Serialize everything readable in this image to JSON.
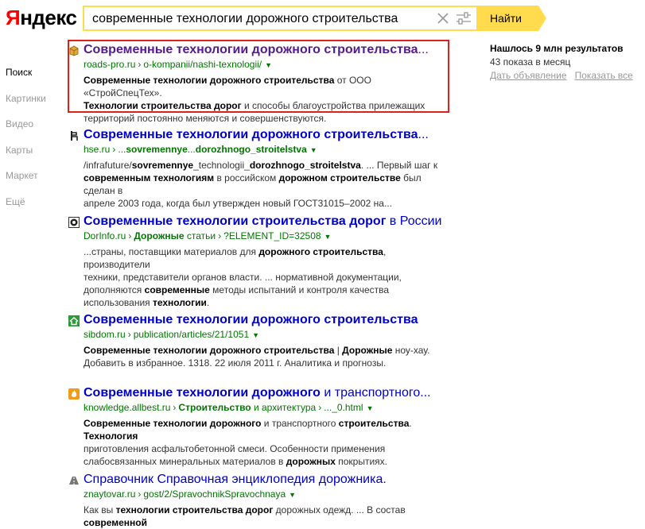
{
  "logo": {
    "part1": "Я",
    "part2": "ндекс"
  },
  "search": {
    "query": "современные технологии дорожного строительства",
    "button_label": "Найти"
  },
  "nav": [
    {
      "label": "Поиск",
      "active": true
    },
    {
      "label": "Картинки"
    },
    {
      "label": "Видео"
    },
    {
      "label": "Карты"
    },
    {
      "label": "Маркет"
    },
    {
      "label": "Ещё"
    }
  ],
  "results": [
    {
      "favicon": "box-icon",
      "title_html": "<b>Современные технологии дорожного строительства</b>...",
      "visited": true,
      "url_parts": [
        "roads-pro.ru",
        "o-kompanii/nashi-texnologii/"
      ],
      "snippet_html": "<b>Современные технологии дорожного строительства</b> от ООО «СтройСпецТех».<br><b>Технологии строительства дорог</b> и способы благоустройства прилежащих<br>территорий постоянно меняются и совершенствуются."
    },
    {
      "favicon": "hse-icon",
      "title_html": "<b>Современные технологии дорожного строительства</b>...",
      "url_parts": [
        "hse.ru",
        "...<b>sovremennye</b>...<b>dorozhnogo_stroitelstva</b>"
      ],
      "snippet_html": "/infrafuture/<b>sovremennye</b>_technologii_<b>dorozhnogo_stroitelstva</b>. ... Первый шаг к<br><b>современным технологиям</b> в российском <b>дорожном строительстве</b> был сделан в<br>апреле 2003 года, когда был утвержден новый ГОСТ31015–2002 на..."
    },
    {
      "favicon": "dorinfo-icon",
      "title_html": "<b>Современные технологии строительства дорог</b> в России",
      "url_parts": [
        "DorInfo.ru",
        "<b>Дорожные</b> статьи",
        "?ELEMENT_ID=32508"
      ],
      "snippet_html": "...страны, поставщики материалов для <b>дорожного строительства</b>, производители<br>техники, представители органов власти. ... нормативной документации,<br>дополняются <b>современные</b> методы испытаний и контроля качества<br>использования <b>технологии</b>."
    },
    {
      "favicon": "home-icon",
      "title_html": "<b>Современные технологии дорожного строительства</b>",
      "url_parts": [
        "sibdom.ru",
        "publication/articles/21/1051"
      ],
      "snippet_html": "<b>Современные технологии дорожного строительства</b> | <b>Дорожные</b> ноу-хау.<br>Добавить в избранное. 1318. 22 июля 2011 г. Аналитика и прогнозы."
    },
    {
      "favicon": "fire-icon",
      "title_html": "<b>Современные технологии дорожного</b> и транспортного...",
      "url_parts": [
        "knowledge.allbest.ru",
        "<b>Строительство</b> и архитектура",
        "..._0.html"
      ],
      "snippet_html": "<b>Современные технологии дорожного</b> и транспортного <b>строительства</b>. <b>Технология</b><br>приготовления асфальтобетонной смеси. Особенности применения<br>слабосвязанных минеральных материалов в <b>дорожных</b> покрытиях."
    },
    {
      "favicon": "road-icon",
      "title_html": "Справочник Справочная энциклопедия дорожника.",
      "url_parts": [
        "znaytovar.ru",
        "gost/2/SpravochnikSpravochnaya"
      ],
      "snippet_html": "Как вы <b>технологии строительства дорог</b> дорожных одежд. ... В состав <b>современной</b>"
    }
  ],
  "stats": {
    "found": "Нашлось 9 млн результатов",
    "shows": "43 показа в месяц",
    "ad_link": "Дать объявление",
    "show_all": "Показать все"
  }
}
